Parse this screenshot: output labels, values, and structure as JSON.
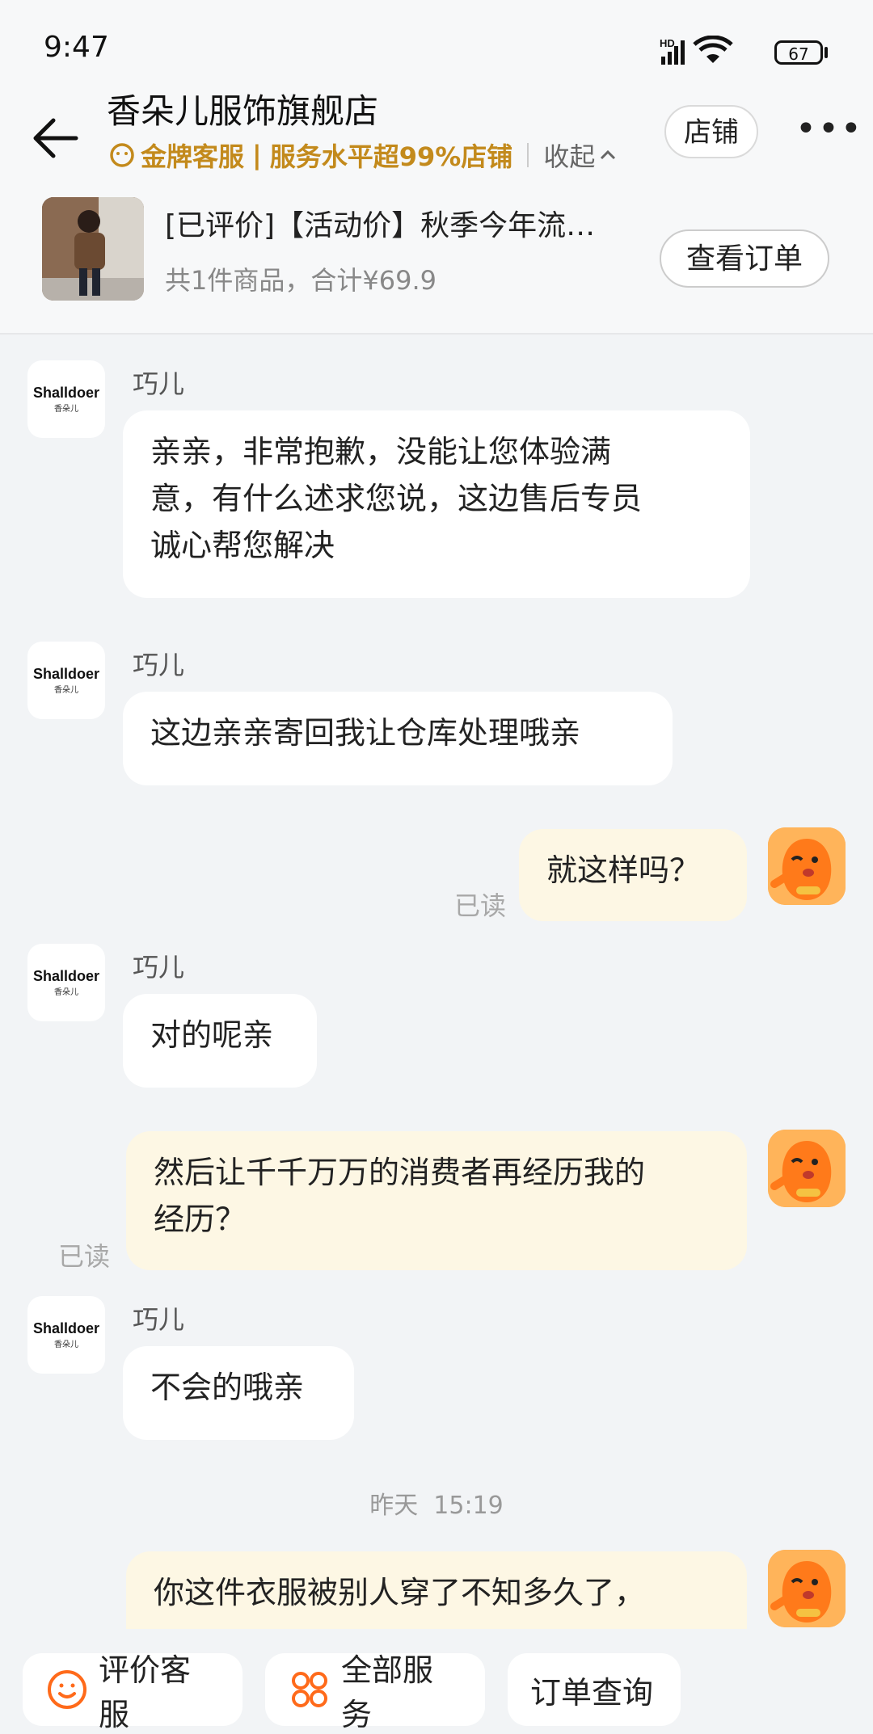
{
  "status": {
    "time": "9:47",
    "network": "HD",
    "battery": "67"
  },
  "header": {
    "shop_name": "香朵儿服饰旗舰店",
    "badge_gold": "金牌客服",
    "badge_sep": "|",
    "badge_service": "服务水平超99%店铺",
    "collapse": "收起",
    "shop_button": "店铺",
    "more": "•••"
  },
  "order": {
    "title": "[已评价]【活动价】秋季今年流…",
    "summary": "共1件商品，合计¥69.9",
    "view_button": "查看订单"
  },
  "avatar_logo": "Shalldoer",
  "avatar_sublogo": "香朵儿",
  "messages": [
    {
      "side": "left",
      "sender": "巧儿",
      "lines": [
        "亲亲，非常抱歉，没能让您体验满",
        "意，有什么述求您说，这边售后专员",
        "诚心帮您解决"
      ]
    },
    {
      "side": "left",
      "sender": "巧儿",
      "lines": [
        "这边亲亲寄回我让仓库处理哦亲"
      ]
    },
    {
      "side": "right",
      "read": "已读",
      "lines": [
        "就这样吗？"
      ]
    },
    {
      "side": "left",
      "sender": "巧儿",
      "lines": [
        "对的呢亲"
      ]
    },
    {
      "side": "right",
      "read": "已读",
      "lines": [
        "然后让千千万万的消费者再经历我的",
        "经历？"
      ]
    },
    {
      "side": "left",
      "sender": "巧儿",
      "lines": [
        "不会的哦亲"
      ]
    },
    {
      "side": "right",
      "lines": [
        "你这件衣服被别人穿了不知多久了，"
      ]
    }
  ],
  "time_separator": "昨天  15:19",
  "bottom": {
    "rate_service": "评价客服",
    "all_services": "全部服务",
    "order_query": "订单查询"
  },
  "colors": {
    "gold": "#c38a1c",
    "bubble_right": "#fdf7e4",
    "background": "#f2f4f6"
  }
}
